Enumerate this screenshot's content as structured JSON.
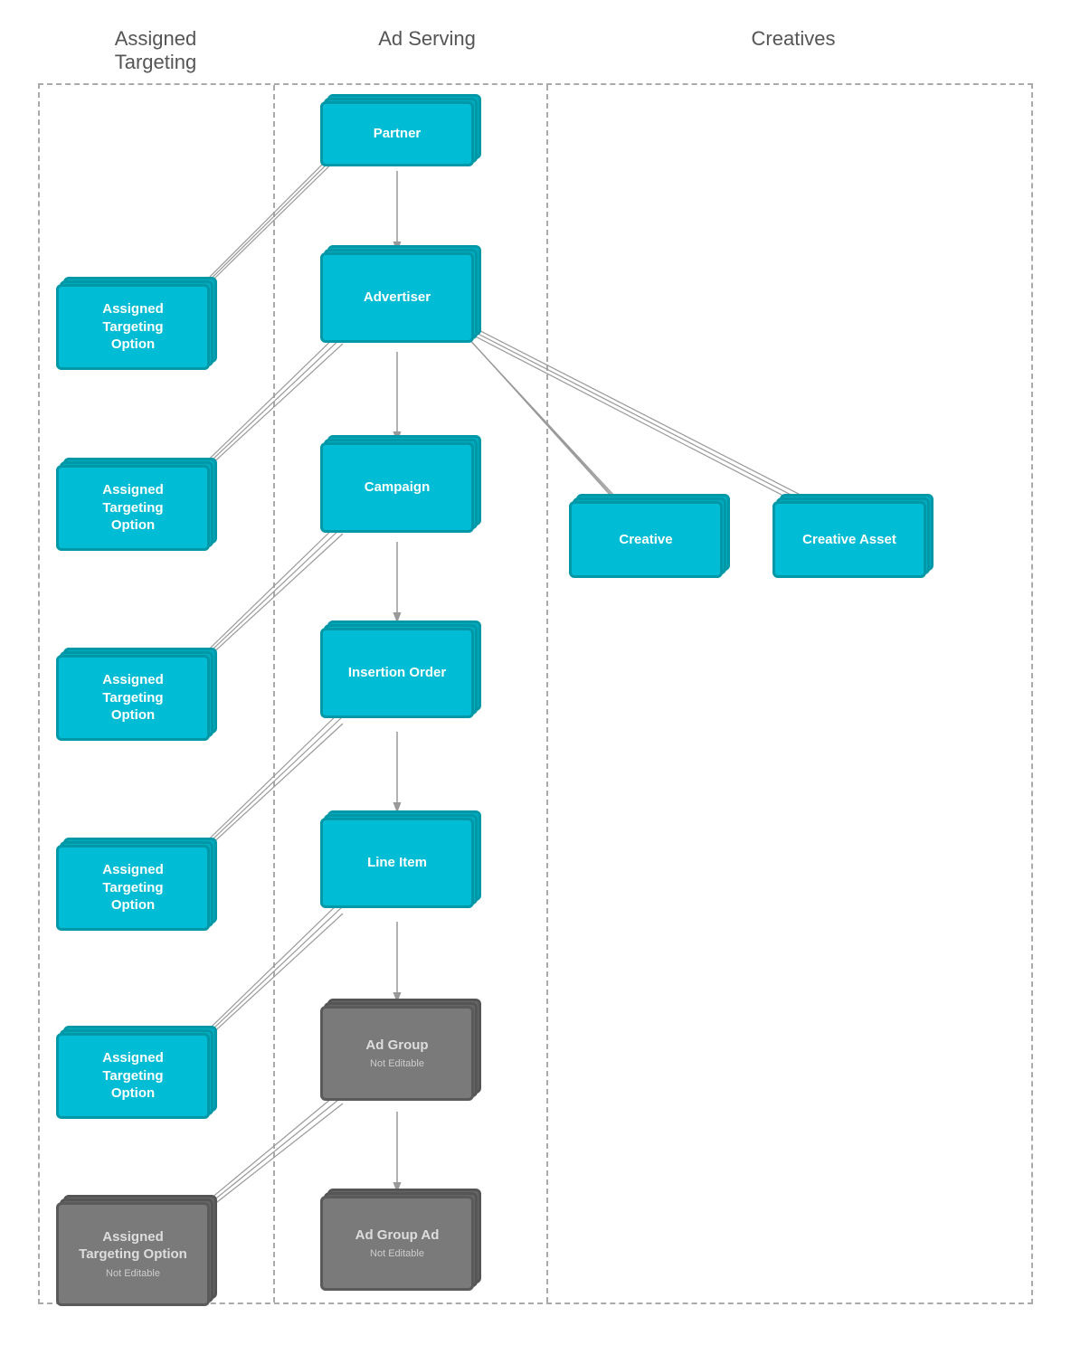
{
  "headers": {
    "col1": "Assigned\nTargeting",
    "col2": "Ad Serving",
    "col3": "Creatives"
  },
  "nodes": {
    "partner": {
      "label": "Partner",
      "type": "teal"
    },
    "advertiser": {
      "label": "Advertiser",
      "type": "teal"
    },
    "campaign": {
      "label": "Campaign",
      "type": "teal"
    },
    "insertion_order": {
      "label": "Insertion Order",
      "type": "teal"
    },
    "line_item": {
      "label": "Line Item",
      "type": "teal"
    },
    "ad_group": {
      "label": "Ad Group",
      "type": "gray",
      "subtitle": "Not Editable"
    },
    "ad_group_ad": {
      "label": "Ad Group Ad",
      "type": "gray",
      "subtitle": "Not Editable"
    },
    "ato1": {
      "label": "Assigned\nTargeting\nOption",
      "type": "teal"
    },
    "ato2": {
      "label": "Assigned\nTargeting\nOption",
      "type": "teal"
    },
    "ato3": {
      "label": "Assigned\nTargeting\nOption",
      "type": "teal"
    },
    "ato4": {
      "label": "Assigned\nTargeting\nOption",
      "type": "teal"
    },
    "ato5": {
      "label": "Assigned\nTargeting\nOption",
      "type": "teal"
    },
    "ato6": {
      "label": "Assigned\nTargeting\nOption",
      "type": "gray",
      "subtitle": "Not Editable"
    },
    "creative": {
      "label": "Creative",
      "type": "teal"
    },
    "creative_asset": {
      "label": "Creative Asset",
      "type": "teal"
    }
  }
}
